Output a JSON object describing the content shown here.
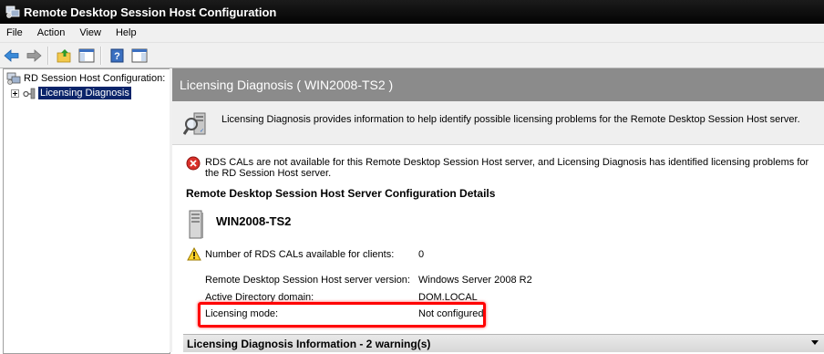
{
  "window": {
    "title": "Remote Desktop Session Host Configuration"
  },
  "menu": [
    "File",
    "Action",
    "View",
    "Help"
  ],
  "toolbar": {
    "buttons": [
      "back-icon",
      "forward-icon",
      "up-folder-icon",
      "show-hide-console-tree-icon",
      "help-icon",
      "action-pane-icon"
    ]
  },
  "tree": {
    "root": "RD Session Host Configuration:",
    "child": "Licensing Diagnosis"
  },
  "panel": {
    "header": "Licensing Diagnosis ( WIN2008-TS2 )",
    "info": "Licensing Diagnosis provides information to help identify possible licensing problems for the Remote Desktop Session Host server.",
    "error": "RDS CALs are not available for this Remote Desktop Session Host server, and Licensing Diagnosis has identified licensing problems for the RD Session Host server.",
    "section_title": "Remote Desktop Session Host Server Configuration Details",
    "server_name": "WIN2008-TS2",
    "details": [
      {
        "label": "Number of RDS CALs available for clients:",
        "value": "0"
      },
      {
        "label": "Remote Desktop Session Host server version:",
        "value": "Windows Server 2008 R2"
      },
      {
        "label": "Active Directory domain:",
        "value": "DOM.LOCAL"
      },
      {
        "label": "Licensing mode:",
        "value": "Not configured"
      }
    ],
    "bottom_section": "Licensing Diagnosis Information - 2 warning(s)"
  },
  "colors": {
    "title_bar": "#000000",
    "selection": "#0a246a",
    "header": "#8b8b8b",
    "highlight": "#ff0000"
  }
}
